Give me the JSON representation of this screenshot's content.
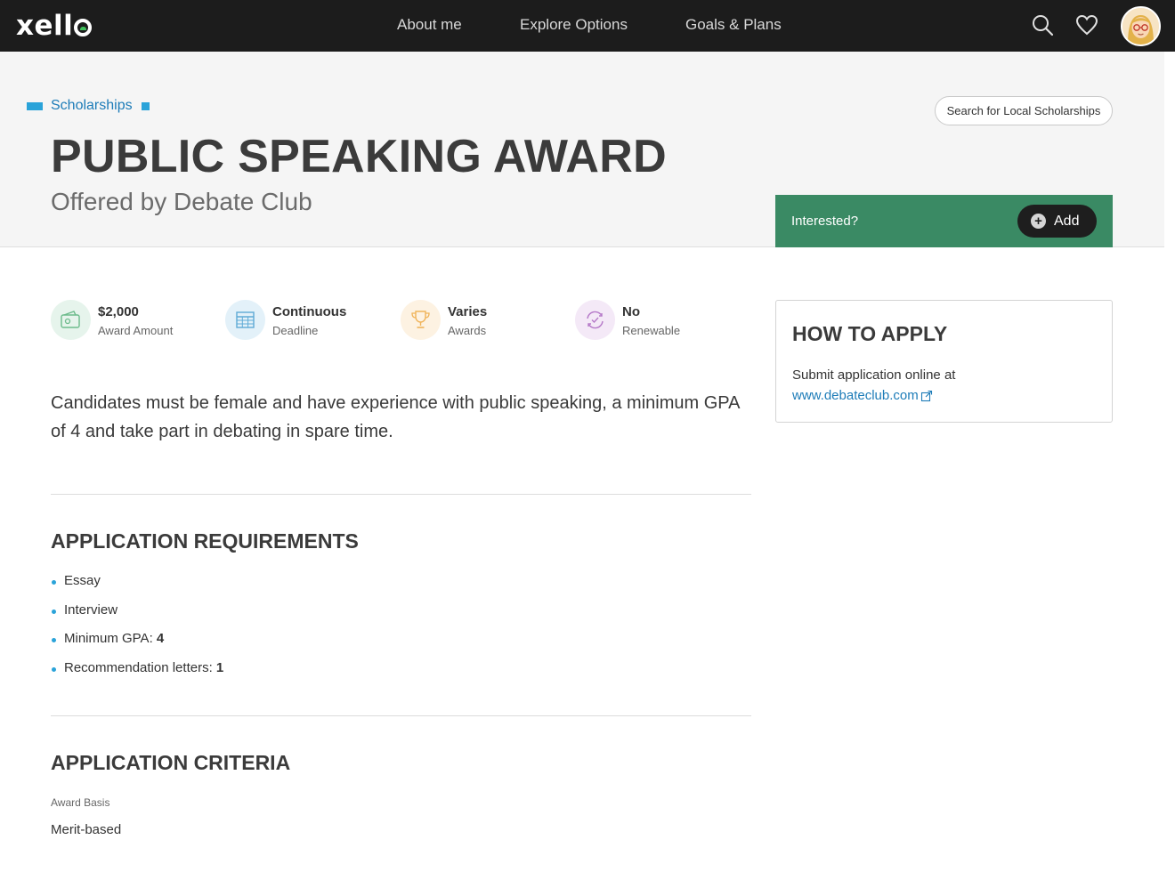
{
  "topbar": {
    "logo": "xello",
    "nav": [
      "About me",
      "Explore Options",
      "Goals & Plans"
    ],
    "icons": [
      "search-icon",
      "heart-icon",
      "avatar"
    ]
  },
  "header": {
    "breadcrumb": "Scholarships",
    "title": "PUBLIC SPEAKING AWARD",
    "subtitle": "Offered by Debate Club",
    "local_button": "Search for Local Scholarships",
    "interested_label": "Interested?",
    "add_button": "Add"
  },
  "stats": [
    {
      "value": "$2,000",
      "caption": "Award Amount",
      "icon": "wallet-icon"
    },
    {
      "value": "Continuous",
      "caption": "Deadline",
      "icon": "calendar-icon"
    },
    {
      "value": "Varies",
      "caption": "Awards",
      "icon": "trophy-icon"
    },
    {
      "value": "No",
      "caption": "Renewable",
      "icon": "renew-icon"
    }
  ],
  "description": "Candidates must be female and have experience with public speaking, a minimum GPA of 4 and take part in debating in spare time.",
  "requirements": {
    "heading": "APPLICATION REQUIREMENTS",
    "items": [
      {
        "label": "Essay",
        "value": ""
      },
      {
        "label": "Interview",
        "value": ""
      },
      {
        "label": "Minimum GPA: ",
        "value": "4"
      },
      {
        "label": "Recommendation letters: ",
        "value": "1"
      }
    ]
  },
  "criteria": {
    "heading": "APPLICATION CRITERIA",
    "basis_label": "Award Basis",
    "basis_value": "Merit-based"
  },
  "apply": {
    "heading": "HOW TO APPLY",
    "text": "Submit application online at",
    "link": "www.debateclub.com"
  },
  "colors": {
    "topbar": "#1c1c1c",
    "accent_blue": "#2aa3d9",
    "interested_green": "#3a8a64",
    "link": "#1d7cb8"
  }
}
